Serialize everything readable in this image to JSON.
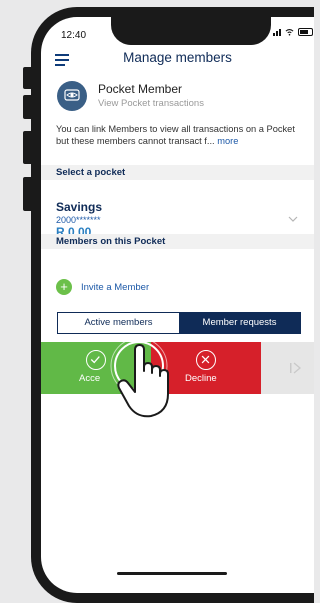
{
  "status_bar": {
    "time": "12:40"
  },
  "header": {
    "title": "Manage members"
  },
  "pocket": {
    "name": "Pocket Member",
    "subtitle": "View Pocket transactions"
  },
  "info": {
    "text": "You can link Members to view all transactions on a Pocket but these members cannot transact f...",
    "more": "more"
  },
  "select_pocket": {
    "heading": "Select a pocket",
    "selected_name": "Savings",
    "account_number": "2000*******",
    "balance": "R 0.00"
  },
  "members": {
    "heading": "Members on this Pocket",
    "invite_label": "Invite a Member"
  },
  "tabs": [
    {
      "label": "Active members",
      "active": true
    },
    {
      "label": "Member requests",
      "active": false
    }
  ],
  "swipe_actions": {
    "accept": "Acce",
    "decline": "Decline"
  },
  "colors": {
    "navy": "#0f2b57",
    "link_blue": "#1e5aa8",
    "accept_green": "#61b947",
    "decline_red": "#d6202a",
    "add_green": "#6cc04a"
  }
}
